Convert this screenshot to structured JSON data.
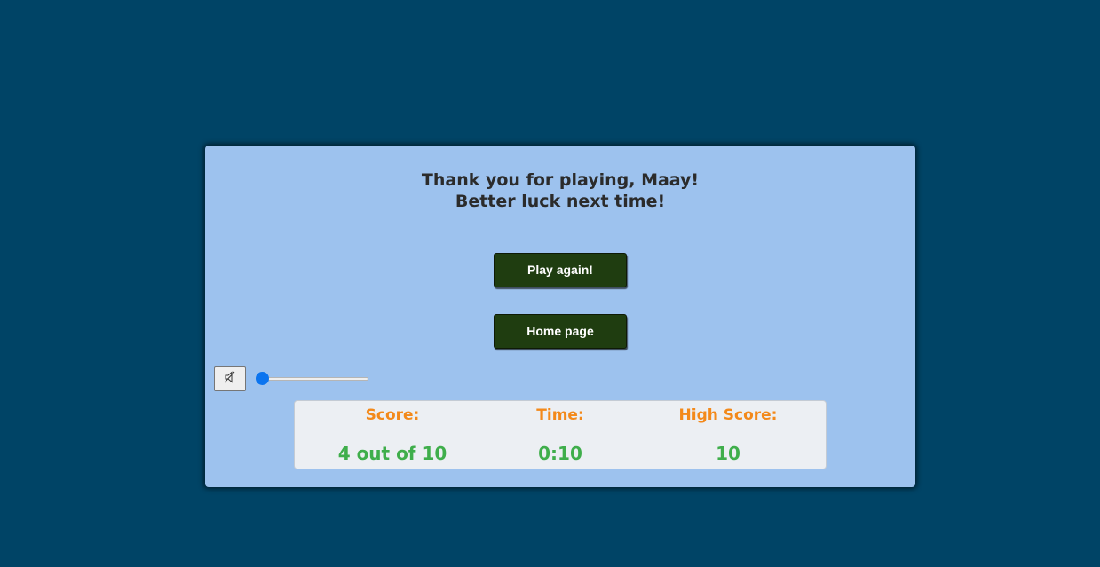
{
  "colors": {
    "background": "#004466",
    "card": "#9dc2ee",
    "button": "#1f3d10",
    "stat_label": "#f3891a",
    "stat_value": "#3fae4b",
    "slider_thumb": "#0b74ef"
  },
  "message": {
    "line1": "Thank you for playing, Maay!",
    "line2": "Better luck next time!"
  },
  "buttons": {
    "play_again": "Play again!",
    "home_page": "Home page"
  },
  "audio": {
    "mute_icon": "speaker-muted-icon",
    "volume_level": 0
  },
  "stats": {
    "score_label": "Score:",
    "score_value": "4 out of 10",
    "time_label": "Time:",
    "time_value": "0:10",
    "high_score_label": "High Score:",
    "high_score_value": "10"
  }
}
